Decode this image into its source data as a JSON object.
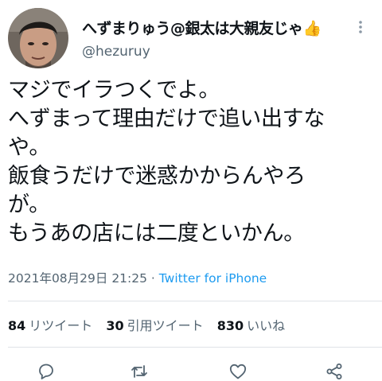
{
  "user": {
    "display_name": "へずまりゅう@銀太は大親友じゃ👍",
    "handle": "@hezuruy"
  },
  "tweet": {
    "lines": [
      "マジでイラつくでよ。",
      "へずまって理由だけで追い出すな",
      "や。",
      "飯食うだけで迷惑かからんやろ",
      "が。",
      "もうあの店には二度といかん。"
    ]
  },
  "meta": {
    "timestamp": "2021年08月29日 21:25",
    "separator": " · ",
    "source": "Twitter for iPhone"
  },
  "stats": {
    "retweets_count": "84",
    "retweets_label": "リツイート",
    "quotes_count": "30",
    "quotes_label": "引用ツイート",
    "likes_count": "830",
    "likes_label": "いいね"
  },
  "icons": {
    "more": "more-vertical-icon",
    "reply": "reply-icon",
    "retweet": "retweet-icon",
    "like": "heart-icon",
    "share": "share-icon"
  },
  "colors": {
    "text": "#0f1419",
    "secondary": "#536471",
    "link": "#1d9bf0",
    "divider": "#dfe3e7"
  }
}
